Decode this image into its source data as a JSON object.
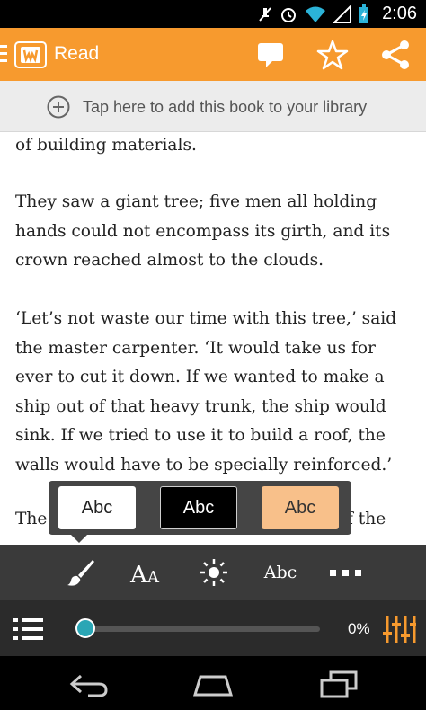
{
  "status_bar": {
    "time": "2:06",
    "icons": [
      "mute-icon",
      "alarm-icon",
      "wifi-icon",
      "signal-icon",
      "battery-icon"
    ]
  },
  "app_bar": {
    "title": "Read",
    "actions": [
      "comment-icon",
      "star-icon",
      "share-icon"
    ],
    "color": "#f79a2e"
  },
  "library_banner": {
    "text": "Tap here to add this book to your library"
  },
  "reader": {
    "paragraphs": [
      "of building materials.",
      "They saw a giant tree; five men all holding hands could not encompass its girth, and its crown reached almost to the clouds.",
      "‘Let’s not waste our time with this tree,’ said the master carpenter. ‘It would take us for ever to cut it down. If we wanted to make a ship out of that heavy trunk, the ship would sink. If we tried to use it to build a roof, the walls would have to be specially reinforced.’",
      "The g",
      "tin",
      "f the"
    ]
  },
  "theme_options": [
    {
      "label": "Abc",
      "bg": "#ffffff",
      "fg": "#222222"
    },
    {
      "label": "Abc",
      "bg": "#000000",
      "fg": "#ffffff"
    },
    {
      "label": "Abc",
      "bg": "#f8c08a",
      "fg": "#333333"
    }
  ],
  "toolbar": {
    "font_style_label": "Abc",
    "more_label": "..."
  },
  "progress": {
    "percent_label": "0%",
    "value": 0,
    "accent": "#2aa6b5"
  }
}
